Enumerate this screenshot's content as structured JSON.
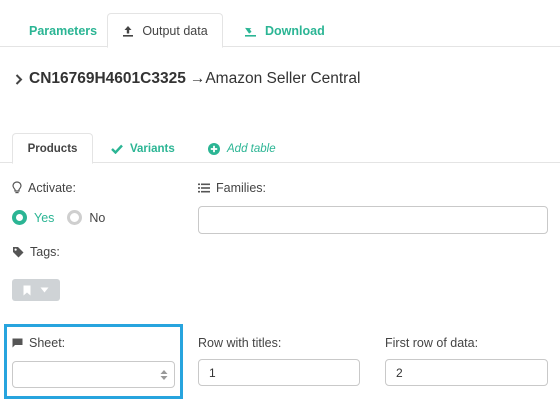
{
  "top_tabs": {
    "parameters": "Parameters",
    "output_data": "Output data",
    "download": "Download"
  },
  "breadcrumb": {
    "code": "CN16769H4601C3325",
    "arrow": "→",
    "destination": "Amazon Seller Central"
  },
  "sub_tabs": {
    "products": "Products",
    "variants": "Variants",
    "add_table": "Add table"
  },
  "form": {
    "activate_label": "Activate:",
    "yes_label": "Yes",
    "no_label": "No",
    "activate_value": "Yes",
    "families_label": "Families:",
    "families_value": "",
    "tags_label": "Tags:",
    "sheet_label": "Sheet:",
    "sheet_value": "",
    "row_titles_label": "Row with titles:",
    "row_titles_value": "1",
    "first_row_label": "First row of data:",
    "first_row_value": "2"
  },
  "colors": {
    "accent": "#2bb594",
    "highlight": "#27a4de"
  }
}
